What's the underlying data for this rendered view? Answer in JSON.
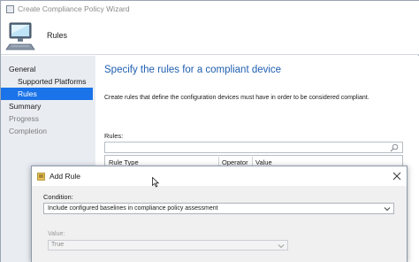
{
  "window": {
    "title": "Create Compliance Policy Wizard"
  },
  "header": {
    "step_title": "Rules"
  },
  "nav": {
    "items": [
      {
        "label": "General",
        "state": "normal"
      },
      {
        "label": "Supported Platforms",
        "state": "normal"
      },
      {
        "label": "Rules",
        "state": "selected"
      },
      {
        "label": "Summary",
        "state": "normal"
      },
      {
        "label": "Progress",
        "state": "disabled"
      },
      {
        "label": "Completion",
        "state": "disabled"
      }
    ]
  },
  "content": {
    "heading": "Specify the rules for a compliant device",
    "description": "Create rules that define the configuration devices must have in order to be considered compliant.",
    "rules_label": "Rules:",
    "table": {
      "columns": [
        "Rule Type",
        "Operator",
        "Value"
      ]
    }
  },
  "dialog": {
    "title": "Add Rule",
    "condition_label": "Condition:",
    "condition_value": "Include configured baselines in compliance policy assessment",
    "value_label": "Value:",
    "value_value": "True"
  },
  "colors": {
    "accent": "#1a73e8",
    "heading": "#1f5fb0",
    "nav_bg": "#e9edf2"
  }
}
